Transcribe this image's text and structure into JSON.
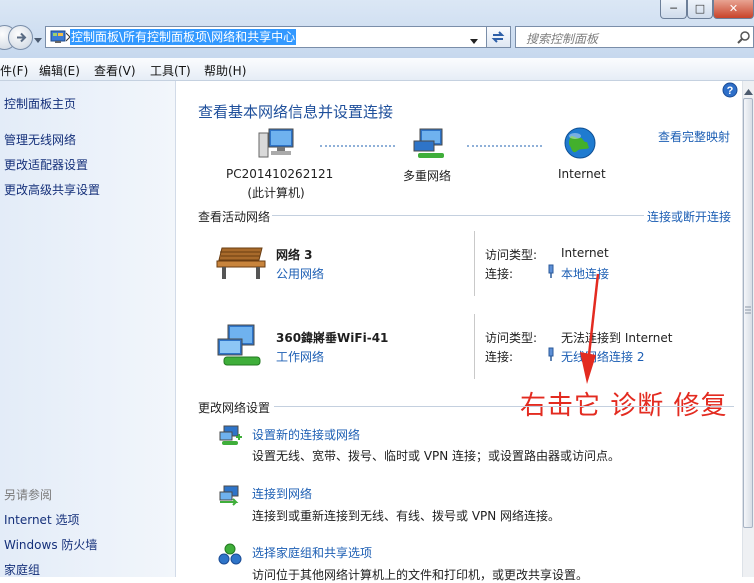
{
  "window": {
    "minimize_glyph": "─",
    "maximize_glyph": "□",
    "close_glyph": "✕"
  },
  "address_bar": {
    "path": "控制面板\\所有控制面板项\\网络和共享中心"
  },
  "search": {
    "placeholder": "搜索控制面板"
  },
  "menu": [
    "件(F)",
    "编辑(E)",
    "查看(V)",
    "工具(T)",
    "帮助(H)"
  ],
  "sidebar": {
    "home": "控制面板主页",
    "items": [
      "管理无线网络",
      "更改适配器设置",
      "更改高级共享设置"
    ],
    "see_also_heading": "另请参阅",
    "see_also": [
      "Internet 选项",
      "Windows 防火墙",
      "家庭组"
    ]
  },
  "main": {
    "title": "查看基本网络信息并设置连接",
    "full_map_link": "查看完整映射",
    "map": {
      "computer_name": "PC201410262121",
      "computer_sub": "(此计算机)",
      "middle_label": "多重网络",
      "internet_label": "Internet"
    },
    "active_networks_heading": "查看活动网络",
    "connect_disconnect_link": "连接或断开连接",
    "networks": [
      {
        "name": "网络  3",
        "type_link": "公用网络",
        "access_label": "访问类型:",
        "access_value": "Internet",
        "conn_label": "连接:",
        "conn_value": "本地连接"
      },
      {
        "name": "360鍏嶈垂WiFi-41",
        "type_link": "工作网络",
        "access_label": "访问类型:",
        "access_value": "无法连接到 Internet",
        "conn_label": "连接:",
        "conn_value": "无线网络连接 2"
      }
    ],
    "change_settings_heading": "更改网络设置",
    "tasks": [
      {
        "link": "设置新的连接或网络",
        "desc": "设置无线、宽带、拨号、临时或 VPN 连接；或设置路由器或访问点。"
      },
      {
        "link": "连接到网络",
        "desc": "连接到或重新连接到无线、有线、拨号或 VPN 网络连接。"
      },
      {
        "link": "选择家庭组和共享选项",
        "desc": "访问位于其他网络计算机上的文件和打印机，或更改共享设置。"
      }
    ]
  },
  "annotation": "右击它 诊断 修复",
  "colors": {
    "link": "#1d5fb4",
    "title": "#1e4f9b",
    "annotation": "#e32b20",
    "address_highlight": "#3399ff"
  }
}
